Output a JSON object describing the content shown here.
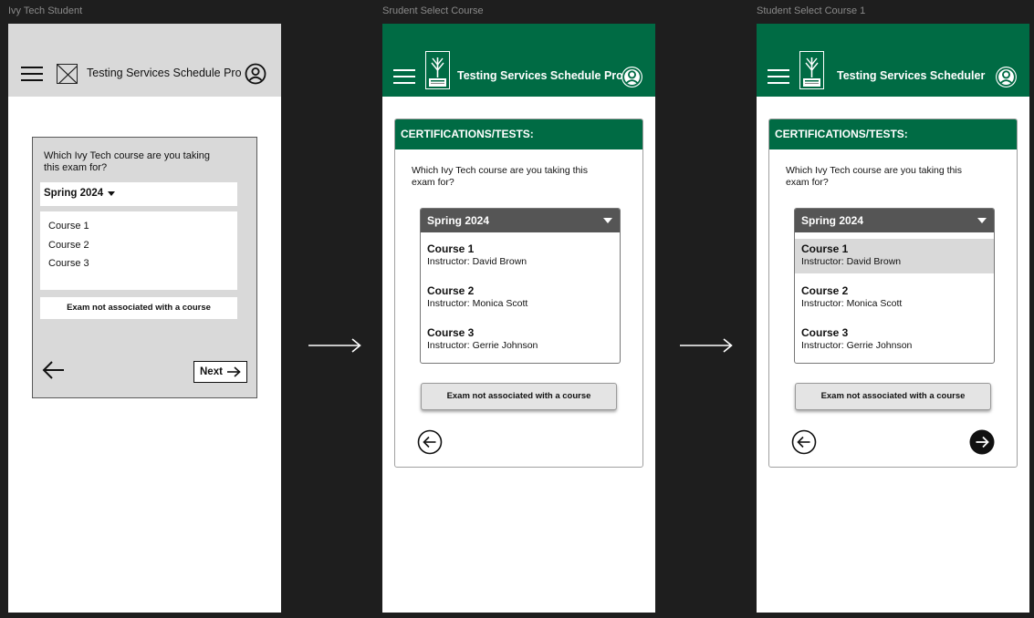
{
  "frames": [
    {
      "label": "Ivy Tech Student",
      "title": "Testing Services Schedule Pro",
      "question": "Which Ivy Tech course are you taking this exam for?",
      "term": "Spring 2024",
      "courses": [
        "Course 1",
        "Course 2",
        "Course 3"
      ],
      "no_course_label": "Exam not associated with a course",
      "next_label": "Next"
    },
    {
      "label": "Srudent Select Course",
      "title": "Testing Services Schedule Pro",
      "card_heading": "CERTIFICATIONS/TESTS:",
      "question": "Which Ivy Tech course are you taking this exam for?",
      "term": "Spring 2024",
      "courses": [
        {
          "name": "Course 1",
          "instructor": "Instructor: David Brown"
        },
        {
          "name": "Course 2",
          "instructor": "Instructor: Monica Scott"
        },
        {
          "name": "Course 3",
          "instructor": "Instructor: Gerrie Johnson"
        }
      ],
      "no_course_label": "Exam not associated with a course"
    },
    {
      "label": "Student Select Course 1",
      "title": "Testing Services Scheduler",
      "card_heading": "CERTIFICATIONS/TESTS:",
      "question": "Which Ivy Tech course are you taking this exam for?",
      "term": "Spring 2024",
      "selected_course": "Course 1",
      "courses": [
        {
          "name": "Course 1",
          "instructor": "Instructor: David Brown"
        },
        {
          "name": "Course 2",
          "instructor": "Instructor: Monica Scott"
        },
        {
          "name": "Course 3",
          "instructor": "Instructor: Gerrie Johnson"
        }
      ],
      "no_course_label": "Exam not associated with a course"
    }
  ],
  "colors": {
    "canvas": "#1e1e1e",
    "brand_green": "#006b44",
    "wireframe_gray": "#d9d9d9",
    "dropdown_header": "#555555",
    "selected_row": "#d9d9d9"
  },
  "icons": [
    "hamburger-menu-icon",
    "logo-placeholder-icon",
    "ivy-tech-logo-icon",
    "user-profile-icon",
    "arrow-left-icon",
    "arrow-right-icon",
    "caret-down-icon",
    "flow-arrow-icon"
  ]
}
